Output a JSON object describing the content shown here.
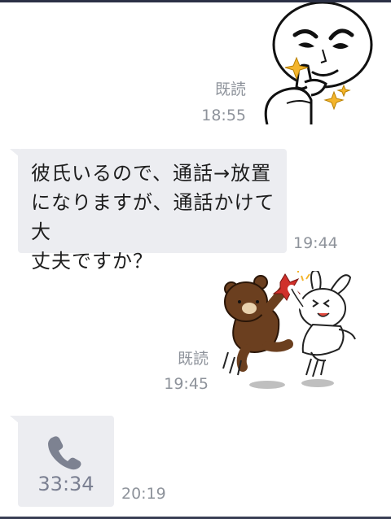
{
  "messages": [
    {
      "type": "sticker",
      "side": "outgoing",
      "sticker": "moon-thumbs-up-sparkle",
      "read_status": "既読",
      "time": "18:55"
    },
    {
      "type": "text",
      "side": "incoming",
      "text": "彼氏いるので、通話→放置\nになりますが、通話かけて大\n丈夫ですか？",
      "time": "19:44"
    },
    {
      "type": "sticker",
      "side": "outgoing",
      "sticker": "brown-cony-high-five",
      "read_status": "既読",
      "time": "19:45"
    },
    {
      "type": "call",
      "side": "incoming",
      "icon": "phone-icon",
      "duration": "33:34",
      "time": "20:19"
    }
  ],
  "colors": {
    "bubble": "#ecedf1",
    "meta_text": "#8e939b",
    "call_icon": "#7d8291",
    "top_bar": "#2b3045"
  }
}
